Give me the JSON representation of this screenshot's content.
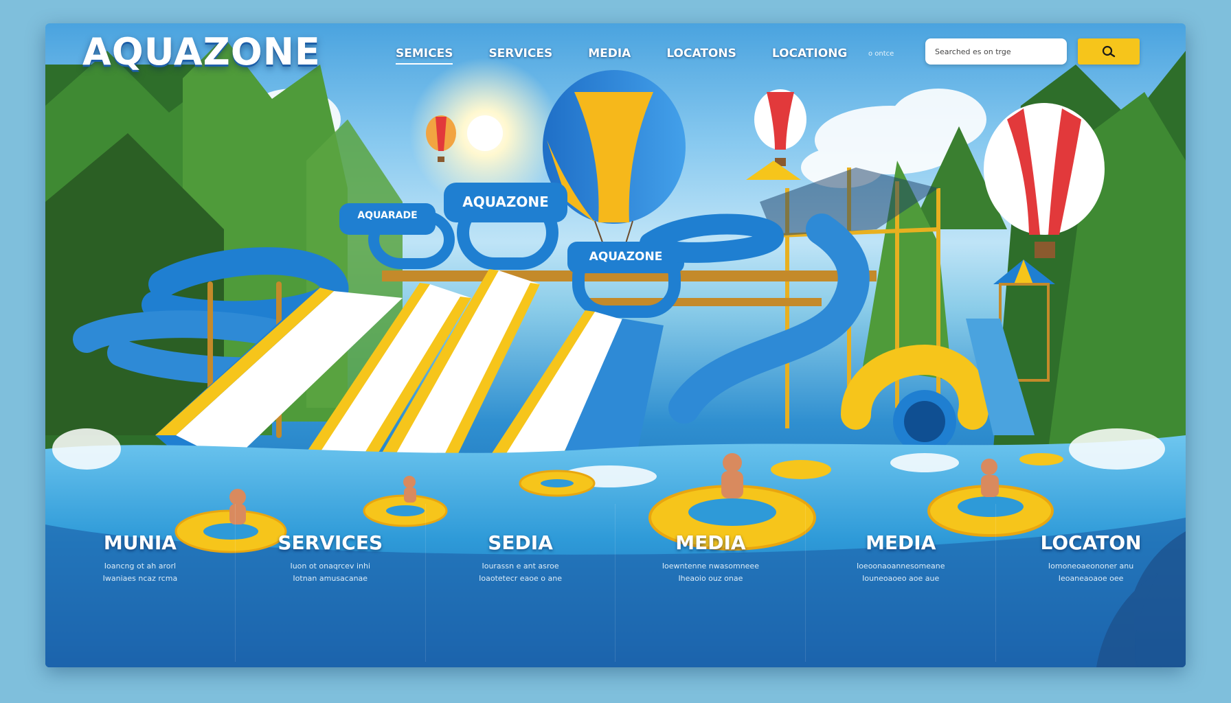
{
  "brand": {
    "name": "AQUAZONE"
  },
  "nav": {
    "items": [
      {
        "label": "SEMICES",
        "active": true
      },
      {
        "label": "SERVICES",
        "active": false
      },
      {
        "label": "MEDIA",
        "active": false
      },
      {
        "label": "LOCATONS",
        "active": false
      },
      {
        "label": "LOCATIONG",
        "active": false
      }
    ]
  },
  "search": {
    "hint": "o ontce",
    "value": "Searched es on trge",
    "button_icon": "search-icon"
  },
  "park_signs": [
    "AQUARADE",
    "AQUAZONE",
    "AQUAZONE"
  ],
  "sections": [
    {
      "title": "MUNIA",
      "lines": [
        "Ioancng ot ah arorl",
        "Iwaniaes ncaz rcma"
      ]
    },
    {
      "title": "SERVICES",
      "lines": [
        "Iuon ot onaqrcev inhi",
        "Iotnan amusacanae"
      ]
    },
    {
      "title": "SEDIA",
      "lines": [
        "Iourassn e ant asroe",
        "Ioaotetecr eaoe o ane"
      ]
    },
    {
      "title": "MEDIA",
      "lines": [
        "Ioewntenne nwasomneee",
        "Iheaoio ouz onae"
      ]
    },
    {
      "title": "MEDIA",
      "lines": [
        "Ioeoonaoannesomeane",
        "Iouneoaoeo aoe aue"
      ]
    },
    {
      "title": "LOCATON",
      "lines": [
        "Iomoneoaeononer anu",
        "Ieoaneaoaoe oee"
      ]
    }
  ],
  "colors": {
    "brand_blue": "#1f7fd1",
    "accent_yellow": "#f6c51b",
    "slide_red": "#e2393b",
    "water": "#2e9ad8"
  }
}
